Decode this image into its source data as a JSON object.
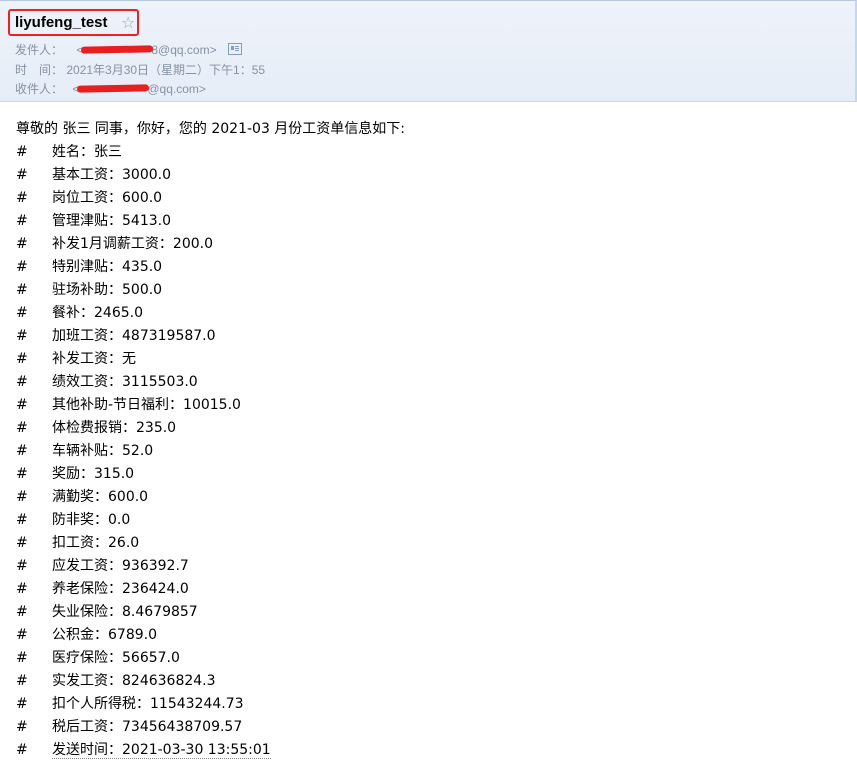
{
  "header": {
    "subject": "liyufeng_test",
    "star_icon": "star-outline-icon",
    "from_label": "发件人：",
    "from_value_hidden": "████████",
    "from_value_tail": "8@qq.com>",
    "from_value_head": "<",
    "time_label": "时　间：",
    "time_value": "2021年3月30日（星期二）下午1：55",
    "to_label": "收件人：",
    "to_value_head": "<",
    "to_value_hidden": "████████",
    "to_value_tail": "@qq.com>"
  },
  "body": {
    "greeting": "尊敬的 张三 同事，你好，您的 2021-03 月份工资单信息如下:",
    "hash": "#",
    "items": [
      "姓名：张三",
      "基本工资：3000.0",
      "岗位工资：600.0",
      "管理津贴：5413.0",
      "补发1月调薪工资：200.0",
      "特别津贴：435.0",
      "驻场补助：500.0",
      "餐补：2465.0",
      "加班工资：487319587.0",
      "补发工资：无",
      "绩效工资：3115503.0",
      "其他补助-节日福利：10015.0",
      "体检费报销：235.0",
      "车辆补贴：52.0",
      "奖励：315.0",
      "满勤奖：600.0",
      "防非奖：0.0",
      "扣工资：26.0",
      "应发工资：936392.7",
      "养老保险：236424.0",
      "失业保险：8.4679857",
      "公积金：6789.0",
      "医疗保险：56657.0",
      "实发工资：824636824.3",
      "扣个人所得税：11543244.73",
      "税后工资：73456438709.57",
      "发送时间：2021-03-30 13:55:01"
    ]
  }
}
